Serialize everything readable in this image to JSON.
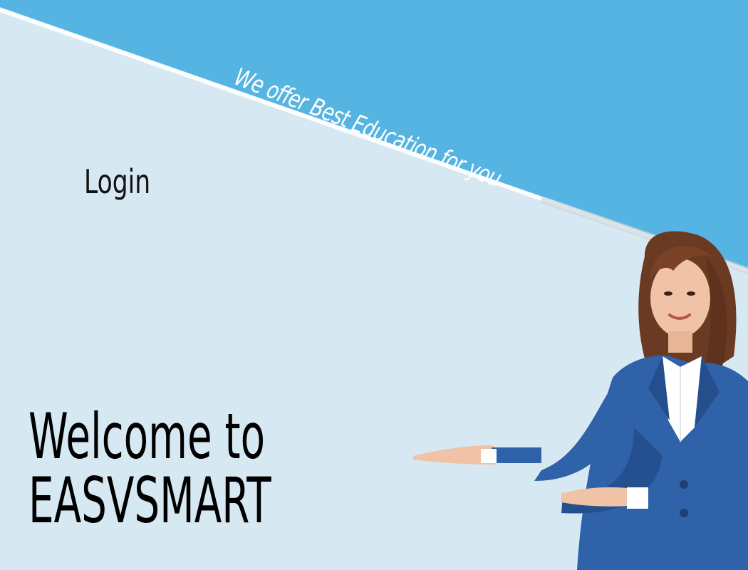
{
  "banner": {
    "tagline": "We offer Best Education for you",
    "color": "#55b4e1"
  },
  "nav": {
    "login_label": "Login"
  },
  "hero": {
    "line1": "Welcome to",
    "line2": "EASVSMART"
  },
  "illustration": {
    "icon": "businesswoman-presenting-illustration"
  }
}
